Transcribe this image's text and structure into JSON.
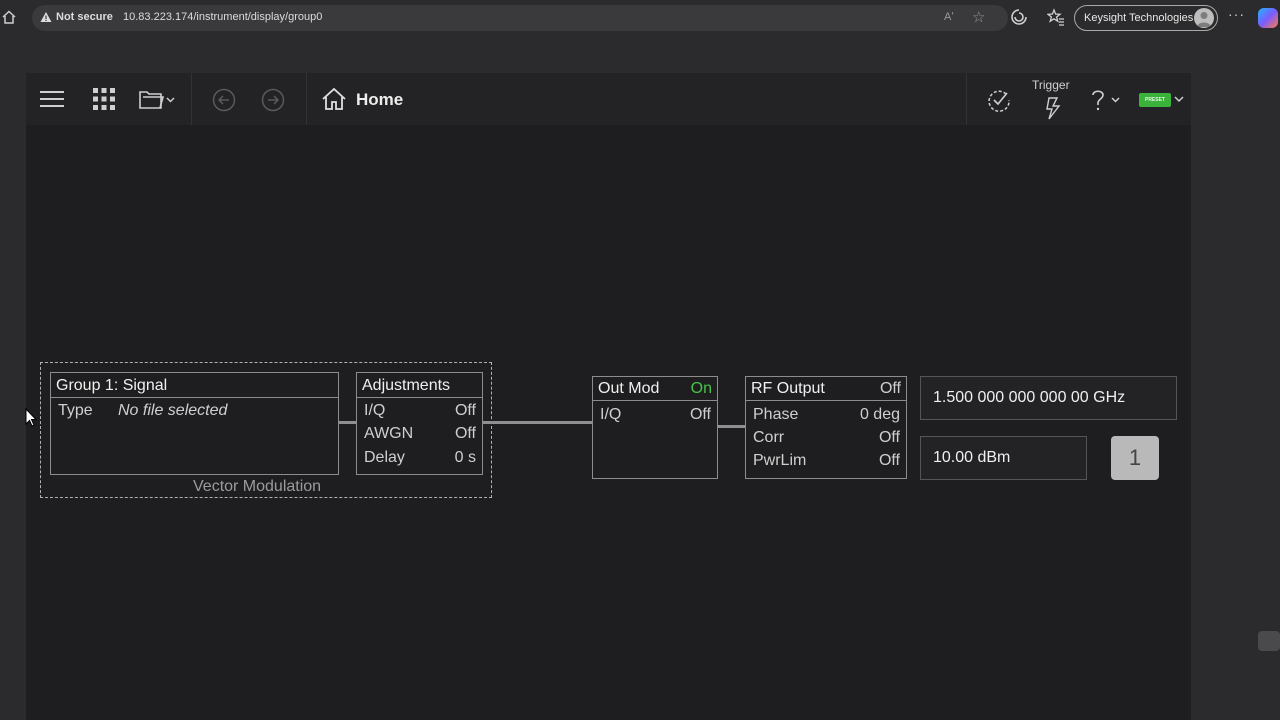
{
  "browser": {
    "security_label": "Not secure",
    "url": "10.83.223.174/instrument/display/group0",
    "readaloud_label": "Aʹ",
    "star_glyph": "☆",
    "profile_name": "Keysight Technologies",
    "more_glyph": "···"
  },
  "toolbar": {
    "title": "Home",
    "trigger_label": "Trigger",
    "preset_label": "PRESET"
  },
  "signal_block": {
    "title": "Group 1: Signal",
    "type_label": "Type",
    "type_value": "No file selected"
  },
  "group_caption": "Vector Modulation",
  "adjustments": {
    "title": "Adjustments",
    "rows": [
      {
        "label": "I/Q",
        "value": "Off"
      },
      {
        "label": "AWGN",
        "value": "Off"
      },
      {
        "label": "Delay",
        "value": "0 s"
      }
    ]
  },
  "out_mod": {
    "title": "Out Mod",
    "status": "On",
    "rows": [
      {
        "label": "I/Q",
        "value": "Off"
      }
    ]
  },
  "rf_output": {
    "title": "RF Output",
    "status": "Off",
    "rows": [
      {
        "label": "Phase",
        "value": "0 deg"
      },
      {
        "label": "Corr",
        "value": "Off"
      },
      {
        "label": "PwrLim",
        "value": "Off"
      }
    ]
  },
  "frequency": "1.500 000 000 000 00 GHz",
  "amplitude": "10.00 dBm",
  "channel_button": "1",
  "colors": {
    "status_on": "#45c545",
    "preset_green": "#3bb33b"
  }
}
